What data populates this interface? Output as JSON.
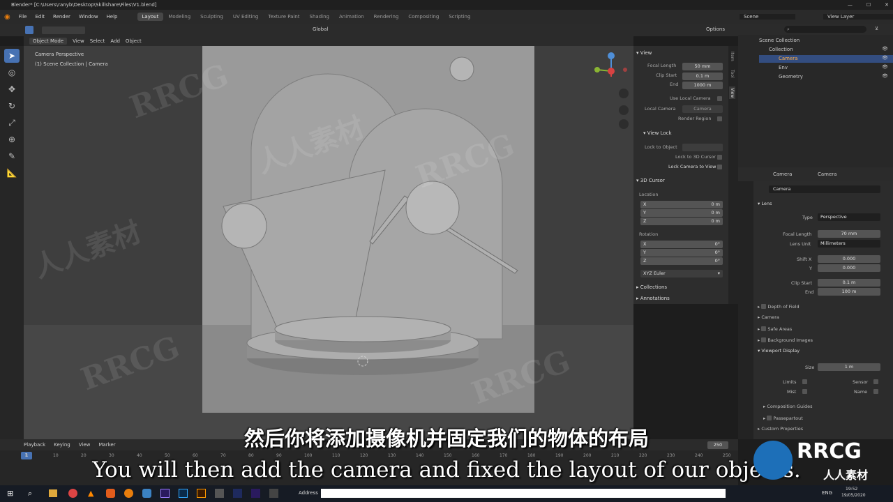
{
  "window": {
    "title": "Blender* [C:\\Users\\ranyb\\Desktop\\Skillshare\\Files\\V1.blend]"
  },
  "menubar": {
    "items": [
      "File",
      "Edit",
      "Render",
      "Window",
      "Help"
    ],
    "workspaces": [
      "Layout",
      "Modeling",
      "Sculpting",
      "UV Editing",
      "Texture Paint",
      "Shading",
      "Animation",
      "Rendering",
      "Compositing",
      "Scripting"
    ],
    "active_workspace": "Layout",
    "scene": "Scene",
    "view_layer": "View Layer"
  },
  "toolbar": {
    "transform": "Global",
    "options": "Options"
  },
  "viewport_header": {
    "mode": "Object Mode",
    "menus": [
      "View",
      "Select",
      "Add",
      "Object"
    ]
  },
  "viewport": {
    "overlay_title": "Camera Perspective",
    "overlay_subtitle": "(1) Scene Collection | Camera",
    "gizmo_x": "X",
    "gizmo_y": "Y",
    "gizmo_z": "Z"
  },
  "npanel": {
    "tabs": [
      "Item",
      "Tool",
      "View"
    ],
    "view": {
      "header": "View",
      "focal_length_label": "Focal Length",
      "focal_length": "50 mm",
      "clip_start_label": "Clip Start",
      "clip_start": "0.1 m",
      "end_label": "End",
      "end": "1000 m",
      "use_local_camera": "Use Local Camera",
      "local_camera_label": "Local Camera",
      "local_camera": "Camera",
      "render_region": "Render Region"
    },
    "view_lock": {
      "header": "View Lock",
      "lock_to_object": "Lock to Object",
      "lock_to_3d_cursor": "Lock to 3D Cursor",
      "lock_camera_to_view": "Lock Camera to View"
    },
    "cursor": {
      "header": "3D Cursor",
      "location_label": "Location",
      "loc": [
        {
          "axis": "X",
          "value": "0 m"
        },
        {
          "axis": "Y",
          "value": "0 m"
        },
        {
          "axis": "Z",
          "value": "0 m"
        }
      ],
      "rotation_label": "Rotation",
      "rot": [
        {
          "axis": "X",
          "value": "0°"
        },
        {
          "axis": "Y",
          "value": "0°"
        },
        {
          "axis": "Z",
          "value": "0°"
        }
      ],
      "rotation_mode": "XYZ Euler"
    },
    "collections": "Collections",
    "annotations": "Annotations"
  },
  "outliner": {
    "root": "Scene Collection",
    "items": [
      "Collection",
      "Camera",
      "Env",
      "Geometry"
    ]
  },
  "properties": {
    "breadcrumb_object": "Camera",
    "breadcrumb_data": "Camera",
    "data_name": "Camera",
    "lens_header": "Lens",
    "type_label": "Type",
    "type": "Perspective",
    "focal_length_label": "Focal Length",
    "focal_length": "70 mm",
    "lens_unit_label": "Lens Unit",
    "lens_unit": "Millimeters",
    "shift_x_label": "Shift X",
    "shift_x": "0.000",
    "shift_y_label": "Y",
    "shift_y": "0.000",
    "clip_start_label": "Clip Start",
    "clip_start": "0.1 m",
    "clip_end_label": "End",
    "clip_end": "100 m",
    "depth_of_field": "Depth of Field",
    "camera": "Camera",
    "safe_areas": "Safe Areas",
    "background_images": "Background Images",
    "viewport_display": "Viewport Display",
    "size_label": "Size",
    "size": "1 m",
    "limits": "Limits",
    "sensor": "Sensor",
    "mist": "Mist",
    "name": "Name",
    "composition_guides": "Composition Guides",
    "passepartout": "Passepartout",
    "custom_properties": "Custom Properties"
  },
  "timeline": {
    "menus": [
      "Playback",
      "Keying",
      "View",
      "Marker"
    ],
    "current_frame": "1",
    "end_frame": "250",
    "ticks": [
      "0",
      "10",
      "20",
      "30",
      "40",
      "50",
      "60",
      "70",
      "80",
      "90",
      "100",
      "110",
      "120",
      "130",
      "140",
      "150",
      "160",
      "170",
      "180",
      "190",
      "200",
      "210",
      "220",
      "230",
      "240",
      "250"
    ]
  },
  "taskbar": {
    "address_label": "Address",
    "lang": "ENG",
    "time": "19:52",
    "date": "19/05/2020"
  },
  "subtitles": {
    "cn": "然后你将添加摄像机并固定我们的物体的布局",
    "en": "You will then add the camera and fixed the layout of our objects."
  },
  "watermark": {
    "text": "RRCG",
    "cn": "人人素材"
  },
  "colors": {
    "accent": "#4772b3",
    "viewport_bg": "#3f3f3f",
    "camera_frame": "#8b8b8b"
  }
}
